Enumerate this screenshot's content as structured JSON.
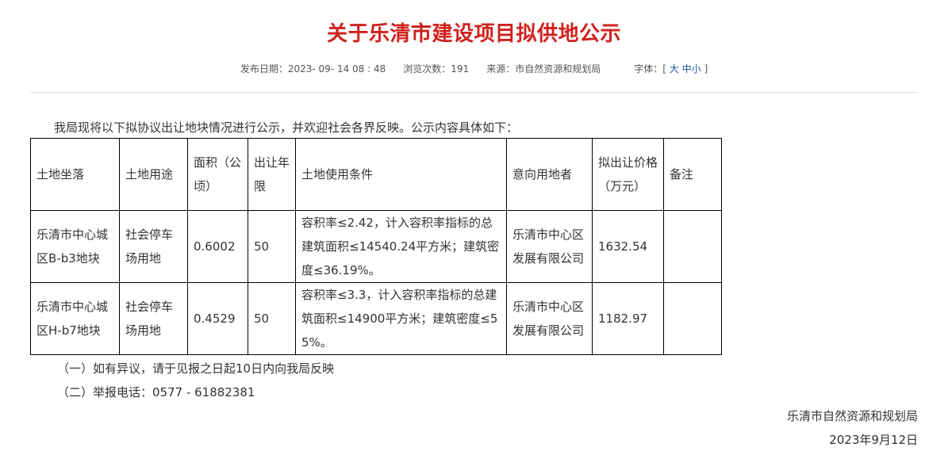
{
  "title": "关于乐清市建设项目拟供地公示",
  "meta": {
    "publish_label": "发布日期：",
    "publish_date": "2023- 09- 14 08 : 48",
    "views_label": "浏览次数：",
    "views": "191",
    "source_label": "来源：",
    "source": "市自然资源和规划局",
    "font_label": "字体：",
    "bracket_open": "[",
    "font_large": "大",
    "font_medium": "中",
    "font_small": "小",
    "bracket_close": "]"
  },
  "intro": "我局现将以下拟协议出让地块情况进行公示，并欢迎社会各界反映。公示内容具体如下：",
  "table": {
    "headers": [
      "土地坐落",
      "土地用途",
      "面积（公顷）",
      "出让年限",
      "土地使用条件",
      "意向用地者",
      "拟出让价格（万元）",
      "备注"
    ],
    "rows": [
      [
        "乐清市中心城区B-b3地块",
        "社会停车场用地",
        "0.6002",
        "50",
        "容积率≤2.42，计入容积率指标的总建筑面积≤14540.24平方米；建筑密度≤36.19%。",
        "乐清市中心区发展有限公司",
        "1632.54",
        ""
      ],
      [
        "乐清市中心城区H-b7地块",
        "社会停车场用地",
        "0.4529",
        "50",
        "容积率≤3.3，计入容积率指标的总建筑面积≤14900平方米；建筑密度≤55%。",
        "乐清市中心区发展有限公司",
        "1182.97",
        ""
      ]
    ]
  },
  "notes": [
    "（一）如有异议，请于见报之日起10日内向我局反映",
    "（二）举报电话：0577 - 61882381"
  ],
  "signature": {
    "org": "乐清市自然资源和规划局",
    "date": "2023年9月12日"
  },
  "colors": {
    "title": "#d0211c",
    "link": "#1a55a8",
    "text": "#333333"
  }
}
